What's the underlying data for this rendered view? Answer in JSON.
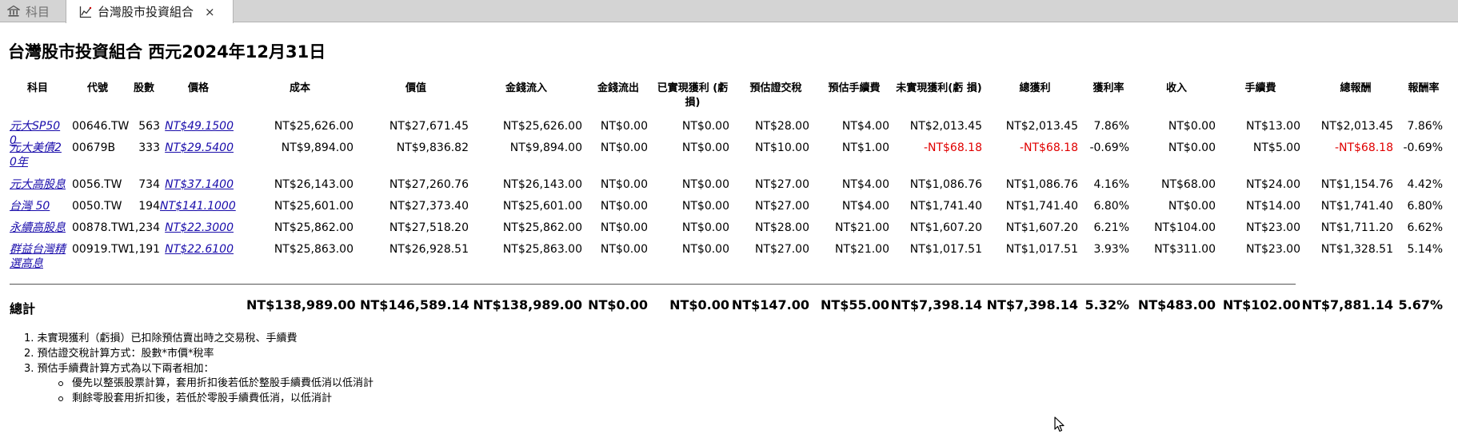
{
  "tabs": [
    {
      "label": "科目",
      "icon": "bank-icon",
      "active": false
    },
    {
      "label": "台灣股市投資組合",
      "icon": "chart-icon",
      "active": true,
      "close": "×"
    }
  ],
  "report": {
    "title": "台灣股市投資組合 西元2024年12月31日",
    "headers": [
      "科目",
      "代號",
      "股數",
      "價格",
      "成本",
      "價值",
      "金錢流入",
      "金錢流出",
      "已實現獲利 (虧損)",
      "預估證交稅",
      "預估手續費",
      "未實現獲利(虧 損)",
      "總獲利",
      "獲利率",
      "收入",
      "手續費",
      "總報酬",
      "報酬率"
    ],
    "rows": [
      {
        "name": "元大SP500",
        "code": "00646.TW",
        "shares": "563",
        "price": "NT$49.1500",
        "cost": "NT$25,626.00",
        "value": "NT$27,671.45",
        "in": "NT$25,626.00",
        "out": "NT$0.00",
        "realized": "NT$0.00",
        "tax": "NT$28.00",
        "fee_est": "NT$4.00",
        "unrealized": "NT$2,013.45",
        "total_gain": "NT$2,013.45",
        "gain_rate": "7.86%",
        "income": "NT$0.00",
        "fees": "NT$13.00",
        "total_return": "NT$2,013.45",
        "return_rate": "7.86%",
        "negative": false
      },
      {
        "name": "元大美債20年",
        "code": "00679B",
        "shares": "333",
        "price": "NT$29.5400",
        "cost": "NT$9,894.00",
        "value": "NT$9,836.82",
        "in": "NT$9,894.00",
        "out": "NT$0.00",
        "realized": "NT$0.00",
        "tax": "NT$10.00",
        "fee_est": "NT$1.00",
        "unrealized": "-NT$68.18",
        "total_gain": "-NT$68.18",
        "gain_rate": "-0.69%",
        "income": "NT$0.00",
        "fees": "NT$5.00",
        "total_return": "-NT$68.18",
        "return_rate": "-0.69%",
        "negative": true
      },
      {
        "name": "元大高股息",
        "code": "0056.TW",
        "shares": "734",
        "price": "NT$37.1400",
        "cost": "NT$26,143.00",
        "value": "NT$27,260.76",
        "in": "NT$26,143.00",
        "out": "NT$0.00",
        "realized": "NT$0.00",
        "tax": "NT$27.00",
        "fee_est": "NT$4.00",
        "unrealized": "NT$1,086.76",
        "total_gain": "NT$1,086.76",
        "gain_rate": "4.16%",
        "income": "NT$68.00",
        "fees": "NT$24.00",
        "total_return": "NT$1,154.76",
        "return_rate": "4.42%",
        "negative": false
      },
      {
        "name": "台灣 50",
        "code": "0050.TW",
        "shares": "194",
        "price": "NT$141.1000",
        "cost": "NT$25,601.00",
        "value": "NT$27,373.40",
        "in": "NT$25,601.00",
        "out": "NT$0.00",
        "realized": "NT$0.00",
        "tax": "NT$27.00",
        "fee_est": "NT$4.00",
        "unrealized": "NT$1,741.40",
        "total_gain": "NT$1,741.40",
        "gain_rate": "6.80%",
        "income": "NT$0.00",
        "fees": "NT$14.00",
        "total_return": "NT$1,741.40",
        "return_rate": "6.80%",
        "negative": false
      },
      {
        "name": "永續高股息",
        "code": "00878.TW",
        "shares": "1,234",
        "price": "NT$22.3000",
        "cost": "NT$25,862.00",
        "value": "NT$27,518.20",
        "in": "NT$25,862.00",
        "out": "NT$0.00",
        "realized": "NT$0.00",
        "tax": "NT$28.00",
        "fee_est": "NT$21.00",
        "unrealized": "NT$1,607.20",
        "total_gain": "NT$1,607.20",
        "gain_rate": "6.21%",
        "income": "NT$104.00",
        "fees": "NT$23.00",
        "total_return": "NT$1,711.20",
        "return_rate": "6.62%",
        "negative": false
      },
      {
        "name": "群益台灣精選高息",
        "code": "00919.TW",
        "shares": "1,191",
        "price": "NT$22.6100",
        "cost": "NT$25,863.00",
        "value": "NT$26,928.51",
        "in": "NT$25,863.00",
        "out": "NT$0.00",
        "realized": "NT$0.00",
        "tax": "NT$27.00",
        "fee_est": "NT$21.00",
        "unrealized": "NT$1,017.51",
        "total_gain": "NT$1,017.51",
        "gain_rate": "3.93%",
        "income": "NT$311.00",
        "fees": "NT$23.00",
        "total_return": "NT$1,328.51",
        "return_rate": "5.14%",
        "negative": false
      }
    ],
    "totals": {
      "label": "總計",
      "cost": "NT$138,989.00",
      "value": "NT$146,589.14",
      "in": "NT$138,989.00",
      "out": "NT$0.00",
      "realized": "NT$0.00",
      "tax": "NT$147.00",
      "fee_est": "NT$55.00",
      "unrealized": "NT$7,398.14",
      "total_gain": "NT$7,398.14",
      "gain_rate": "5.32%",
      "income": "NT$483.00",
      "fees": "NT$102.00",
      "total_return": "NT$7,881.14",
      "return_rate": "5.67%"
    },
    "notes": [
      "1.  未實現獲利（虧損）已扣除預估賣出時之交易稅、手續費",
      "2.  預估證交稅計算方式：股數*市價*稅率",
      "3.  預估手續費計算方式為以下兩者相加："
    ],
    "subnotes": [
      "優先以整張股票計算，套用折扣後若低於整股手續費低消以低消計",
      "剩餘零股套用折扣後，若低於零股手續費低消，以低消計"
    ]
  },
  "colors": {
    "negative": "#e00000",
    "link": "#1a0dab"
  }
}
